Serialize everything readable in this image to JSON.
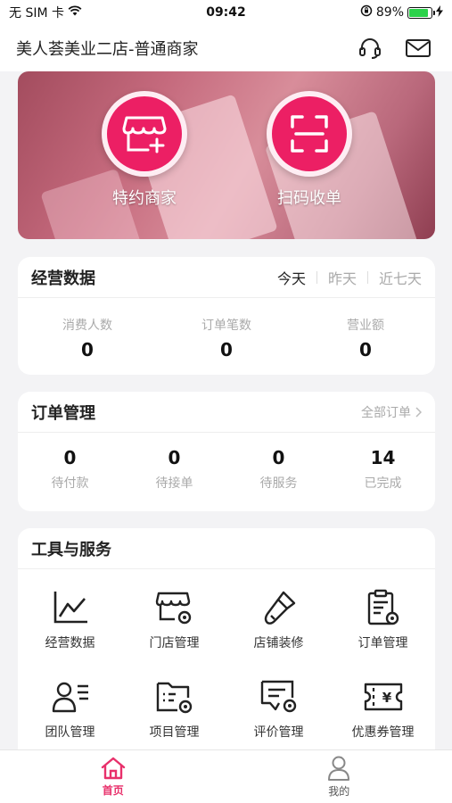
{
  "status_bar": {
    "carrier": "无 SIM 卡",
    "time": "09:42",
    "battery": "89%",
    "battery_level": 0.89
  },
  "header": {
    "title": "美人荟美业二店-普通商家"
  },
  "banner": {
    "actions": [
      {
        "label": "特约商家"
      },
      {
        "label": "扫码收单"
      }
    ]
  },
  "business": {
    "title": "经营数据",
    "tabs": [
      "今天",
      "昨天",
      "近七天"
    ],
    "active_tab": "今天",
    "stats": [
      {
        "label": "消费人数",
        "value": "0"
      },
      {
        "label": "订单笔数",
        "value": "0"
      },
      {
        "label": "营业额",
        "value": "0"
      }
    ]
  },
  "orders": {
    "title": "订单管理",
    "more": "全部订单",
    "items": [
      {
        "value": "0",
        "label": "待付款"
      },
      {
        "value": "0",
        "label": "待接单"
      },
      {
        "value": "0",
        "label": "待服务"
      },
      {
        "value": "14",
        "label": "已完成"
      }
    ]
  },
  "tools": {
    "title": "工具与服务",
    "items": [
      {
        "label": "经营数据",
        "icon": "line-chart-icon"
      },
      {
        "label": "门店管理",
        "icon": "store-settings-icon"
      },
      {
        "label": "店铺装修",
        "icon": "brush-icon"
      },
      {
        "label": "订单管理",
        "icon": "clipboard-settings-icon"
      },
      {
        "label": "团队管理",
        "icon": "user-list-icon"
      },
      {
        "label": "项目管理",
        "icon": "folder-settings-icon"
      },
      {
        "label": "评价管理",
        "icon": "comment-settings-icon"
      },
      {
        "label": "优惠券管理",
        "icon": "coupon-icon"
      }
    ]
  },
  "tabbar": {
    "items": [
      {
        "label": "首页",
        "icon": "home-icon"
      },
      {
        "label": "我的",
        "icon": "user-icon"
      }
    ]
  },
  "colors": {
    "accent": "#e8306b",
    "banner_circle": "#ec1f64"
  }
}
